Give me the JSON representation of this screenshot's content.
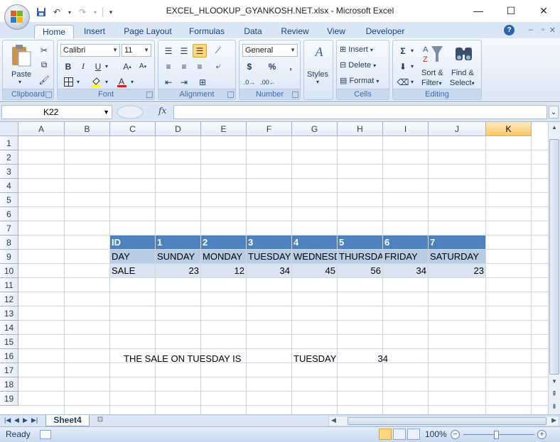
{
  "window": {
    "title": "EXCEL_HLOOKUP_GYANKOSH.NET.xlsx - Microsoft Excel",
    "minimize": "—",
    "maximize": "☐",
    "close": "✕"
  },
  "ribbon_tabs": [
    "Home",
    "Insert",
    "Page Layout",
    "Formulas",
    "Data",
    "Review",
    "View",
    "Developer"
  ],
  "ribbon": {
    "clipboard": {
      "label": "Clipboard",
      "paste": "Paste"
    },
    "font": {
      "label": "Font",
      "name": "Calibri",
      "size": "11"
    },
    "alignment": {
      "label": "Alignment"
    },
    "number": {
      "label": "Number",
      "format": "General",
      "currency": "$",
      "percent": "%",
      "comma": ","
    },
    "styles": {
      "label": "Styles"
    },
    "cells": {
      "label": "Cells",
      "insert": "Insert",
      "delete": "Delete",
      "format": "Format"
    },
    "editing": {
      "label": "Editing",
      "sort": "Sort &",
      "filter": "Filter",
      "find": "Find &",
      "select": "Select"
    }
  },
  "formula_bar": {
    "name_box": "K22",
    "fx": "fx",
    "formula": ""
  },
  "columns": [
    "A",
    "B",
    "C",
    "D",
    "E",
    "F",
    "G",
    "H",
    "I",
    "J",
    "K"
  ],
  "selected_column": "K",
  "rows": [
    "1",
    "2",
    "3",
    "4",
    "5",
    "6",
    "7",
    "8",
    "9",
    "10",
    "11",
    "12",
    "13",
    "14",
    "15",
    "16",
    "17",
    "18",
    "19"
  ],
  "table": {
    "row8": [
      "ID",
      "1",
      "2",
      "3",
      "4",
      "5",
      "6",
      "7"
    ],
    "row9": [
      "DAY",
      "SUNDAY",
      "MONDAY",
      "TUESDAY",
      "WEDNESDAY",
      "THURSDAY",
      "FRIDAY",
      "SATURDAY"
    ],
    "row10": [
      "SALE",
      "23",
      "12",
      "34",
      "45",
      "56",
      "34",
      "23"
    ]
  },
  "lookup": {
    "label": "THE SALE ON TUESDAY IS",
    "day": "TUESDAY",
    "result": "34"
  },
  "sheet_tab": "Sheet4",
  "status": {
    "mode": "Ready",
    "zoom": "100%"
  },
  "colors": {
    "header_fill": "#4f81bd",
    "band_mid": "#b8cce4",
    "band_light": "#dbe5f1",
    "selected_col": "#f9c96a"
  }
}
